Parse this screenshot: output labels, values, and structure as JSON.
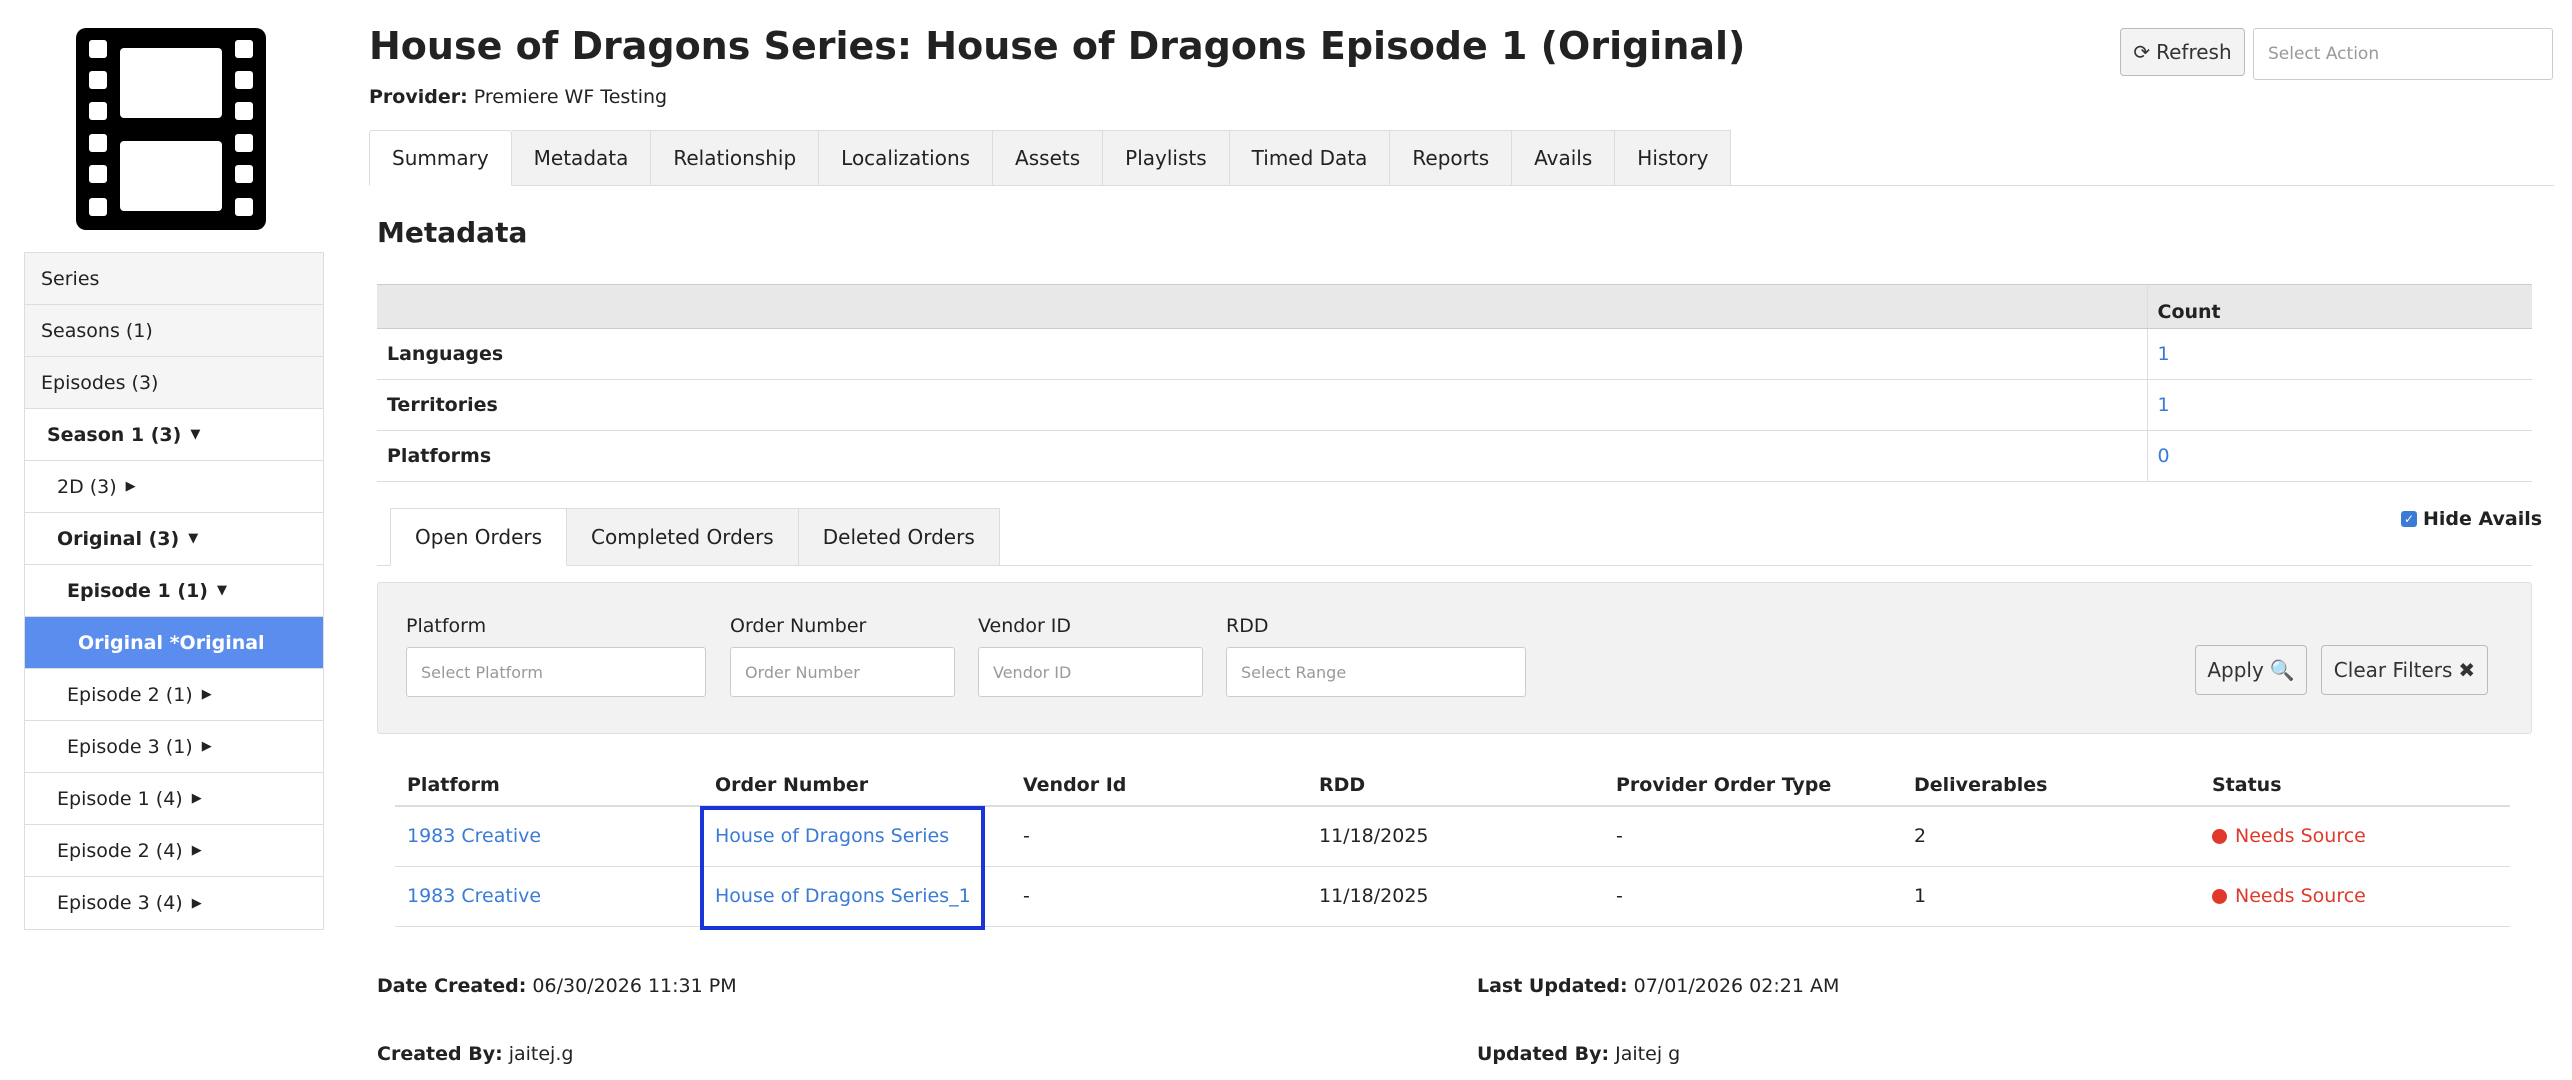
{
  "header": {
    "title": "House of Dragons Series: House of Dragons Episode 1 (Original)",
    "provider_label": "Provider:",
    "provider_value": "Premiere WF Testing",
    "refresh_label": "Refresh",
    "select_action_placeholder": "Select Action"
  },
  "sidebar": {
    "poster_icon": "film-icon",
    "items": [
      {
        "label": "Series",
        "caret": ""
      },
      {
        "label": "Seasons (1)",
        "caret": ""
      },
      {
        "label": "Episodes (3)",
        "caret": ""
      },
      {
        "label": "Season 1 (3)",
        "caret": "▼"
      },
      {
        "label": "2D (3)",
        "caret": "▶"
      },
      {
        "label": "Original (3)",
        "caret": "▼"
      },
      {
        "label": "Episode 1 (1)",
        "caret": "▼"
      },
      {
        "label": "Original *Original",
        "caret": ""
      },
      {
        "label": "Episode 2 (1)",
        "caret": "▶"
      },
      {
        "label": "Episode 3 (1)",
        "caret": "▶"
      },
      {
        "label": "Episode 1 (4)",
        "caret": "▶"
      },
      {
        "label": "Episode 2 (4)",
        "caret": "▶"
      },
      {
        "label": "Episode 3 (4)",
        "caret": "▶"
      }
    ]
  },
  "tabs": [
    "Summary",
    "Metadata",
    "Relationship",
    "Localizations",
    "Assets",
    "Playlists",
    "Timed Data",
    "Reports",
    "Avails",
    "History"
  ],
  "metadata": {
    "title": "Metadata",
    "count_header": "Count",
    "rows": [
      {
        "label": "Languages",
        "count": "1"
      },
      {
        "label": "Territories",
        "count": "1"
      },
      {
        "label": "Platforms",
        "count": "0"
      }
    ]
  },
  "order_tabs": [
    "Open Orders",
    "Completed Orders",
    "Deleted Orders"
  ],
  "hide_avails": {
    "label": "Hide Avails",
    "checked": true
  },
  "filters": {
    "platform_label": "Platform",
    "platform_placeholder": "Select Platform",
    "order_number_label": "Order Number",
    "order_number_placeholder": "Order Number",
    "vendor_id_label": "Vendor ID",
    "vendor_id_placeholder": "Vendor ID",
    "rdd_label": "RDD",
    "rdd_placeholder": "Select Range",
    "apply_label": "Apply",
    "clear_label": "Clear Filters"
  },
  "orders": {
    "columns": [
      "Platform",
      "Order Number",
      "Vendor Id",
      "RDD",
      "Provider Order Type",
      "Deliverables",
      "Status"
    ],
    "rows": [
      {
        "platform": "1983 Creative",
        "order_number": "House of Dragons Series",
        "vendor_id": "-",
        "rdd": "11/18/2025",
        "provider_order_type": "-",
        "deliverables": "2",
        "status": "Needs Source"
      },
      {
        "platform": "1983 Creative",
        "order_number": "House of Dragons Series_1",
        "vendor_id": "-",
        "rdd": "11/18/2025",
        "provider_order_type": "-",
        "deliverables": "1",
        "status": "Needs Source"
      }
    ]
  },
  "info": {
    "date_created_label": "Date Created:",
    "date_created_value": "06/30/2026 11:31 PM",
    "last_updated_label": "Last Updated:",
    "last_updated_value": "07/01/2026 02:21 AM",
    "created_by_label": "Created By:",
    "created_by_value": "jaitej.g",
    "updated_by_label": "Updated By:",
    "updated_by_value": "Jaitej g"
  },
  "colors": {
    "accent": "#3a7bd5",
    "active_nav": "#5b8def",
    "status_red": "#e0392b",
    "highlight_box": "#1a35d6"
  }
}
